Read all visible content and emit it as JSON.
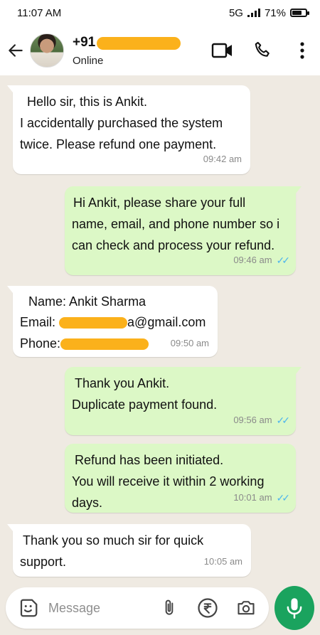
{
  "status_bar": {
    "time": "11:07 AM",
    "network": "5G",
    "battery": "71%",
    "battery_level": 0.71
  },
  "header": {
    "contact_prefix": "+91",
    "status": "Online"
  },
  "messages": [
    {
      "dir": "in",
      "lines": [
        "Hello sir, this is Ankit.",
        "I accidentally purchased the system",
        "twice. Please refund one payment."
      ],
      "time": "09:42 am"
    },
    {
      "dir": "out",
      "lines": [
        "Hi Ankit, please share your full",
        "name, email, and phone number so i",
        "can check and process your refund."
      ],
      "time": "09:46 am"
    },
    {
      "dir": "in",
      "name_line": "Name: Ankit Sharma",
      "email_label": "Email:",
      "email_suffix": "a@gmail.com",
      "phone_label": "Phone:",
      "time": "09:50 am"
    },
    {
      "dir": "out",
      "lines": [
        "Thank you Ankit.",
        "Duplicate payment found."
      ],
      "time": "09:56 am"
    },
    {
      "dir": "out",
      "lines": [
        "Refund has been initiated.",
        "You will receive it within 2 working",
        "days."
      ],
      "time": "10:01 am"
    },
    {
      "dir": "in",
      "lines": [
        "Thank you so much sir for quick",
        "support."
      ],
      "time": "10:05 am"
    }
  ],
  "composer": {
    "placeholder": "Message"
  },
  "colors": {
    "incoming": "#ffffff",
    "outgoing": "#dcf8c6",
    "accent": "#1aa35e",
    "read_ticks": "#4fb6ec",
    "redaction": "#fbb11b"
  },
  "icons": [
    "back-arrow-icon",
    "video-call-icon",
    "phone-icon",
    "more-vert-icon",
    "sticker-icon",
    "attach-icon",
    "rupee-payment-icon",
    "camera-icon",
    "mic-icon",
    "double-check-icon"
  ]
}
